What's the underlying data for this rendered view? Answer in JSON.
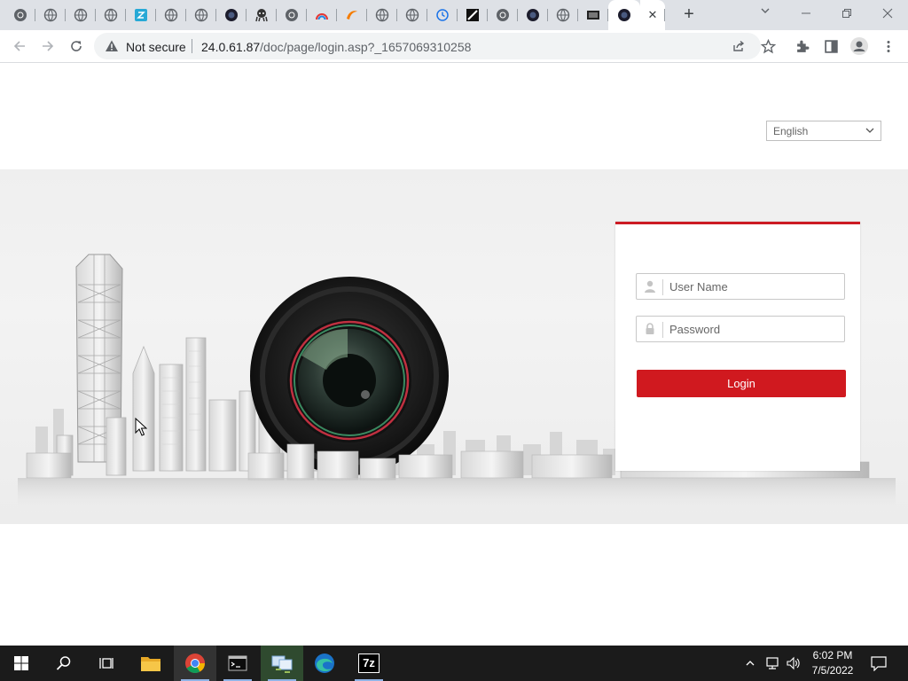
{
  "browser": {
    "tabs": [
      {
        "icon": "chrome-icon"
      },
      {
        "icon": "globe-icon"
      },
      {
        "icon": "globe-icon"
      },
      {
        "icon": "globe-icon"
      },
      {
        "icon": "teal-app-icon"
      },
      {
        "icon": "globe-icon"
      },
      {
        "icon": "globe-icon"
      },
      {
        "icon": "camera-dark-icon"
      },
      {
        "icon": "octopus-icon"
      },
      {
        "icon": "chrome-icon"
      },
      {
        "icon": "rainbow-icon"
      },
      {
        "icon": "orange-swoosh-icon"
      },
      {
        "icon": "globe-icon"
      },
      {
        "icon": "globe-icon"
      },
      {
        "icon": "history-icon"
      },
      {
        "icon": "black-square-icon"
      },
      {
        "icon": "chrome-icon"
      },
      {
        "icon": "camera-dark-icon"
      },
      {
        "icon": "globe-icon"
      },
      {
        "icon": "film-icon"
      },
      {
        "icon": "camera-dark-icon",
        "active": true
      }
    ],
    "new_tab_label": "+",
    "close_tab_label": "✕",
    "security_label": "Not secure",
    "url_host": "24.0.61.87",
    "url_path": "/doc/page/login.asp?_1657069310258"
  },
  "page": {
    "language": "English",
    "username_placeholder": "User Name",
    "password_placeholder": "Password",
    "login_label": "Login",
    "accent_color": "#d0191f"
  },
  "taskbar": {
    "apps": [
      "windows-start",
      "search",
      "task-view",
      "file-explorer",
      "chrome",
      "terminal",
      "remote-desktop",
      "edge",
      "7zip"
    ],
    "seven_zip_label": "7z",
    "time": "6:02 PM",
    "date": "7/5/2022"
  }
}
